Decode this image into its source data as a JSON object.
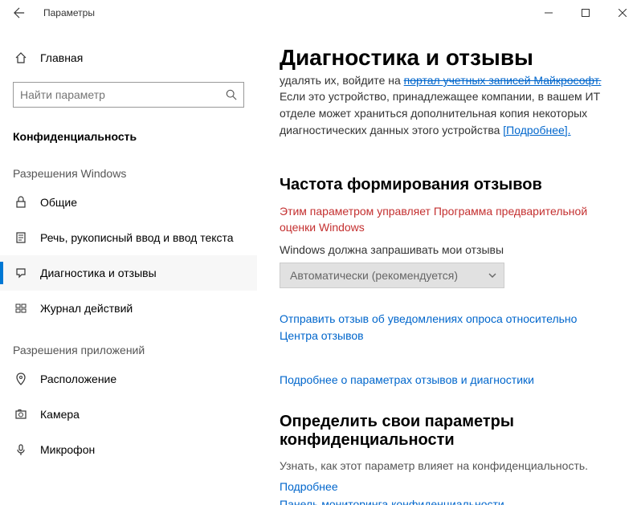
{
  "titlebar": {
    "app_name": "Параметры"
  },
  "sidebar": {
    "home_label": "Главная",
    "search_placeholder": "Найти параметр",
    "section": "Конфиденциальность",
    "group1": "Разрешения Windows",
    "group2": "Разрешения приложений",
    "items_g1": [
      {
        "label": "Общие"
      },
      {
        "label": "Речь, рукописный ввод и ввод текста"
      },
      {
        "label": "Диагностика и отзывы"
      },
      {
        "label": "Журнал действий"
      }
    ],
    "items_g2": [
      {
        "label": "Расположение"
      },
      {
        "label": "Камера"
      },
      {
        "label": "Микрофон"
      }
    ]
  },
  "main": {
    "page_title": "Диагностика и отзывы",
    "trunc_prefix": "удалять их, войдите на ",
    "trunc_link": "портал учетных записей Майкрософт.",
    "body1": "Если это устройство, принадлежащее компании, в вашем ИТ отделе может храниться дополнительная копия некоторых диагностических данных этого устройства ",
    "body1_link": "[Подробнее].",
    "h2_feedback": "Частота формирования отзывов",
    "insider_notice": "Этим параметром управляет Программа предварительной оценки Windows",
    "dropdown_label": "Windows должна запрашивать мои отзывы",
    "dropdown_value": "Автоматически (рекомендуется)",
    "link_send_feedback": "Отправить отзыв об уведомлениях опроса относительно Центра отзывов",
    "link_learn_more_feedback": "Подробнее о параметрах отзывов и диагностики",
    "h2_privacy": "Определить свои параметры конфиденциальности",
    "privacy_subtext": "Узнать, как этот параметр влияет на конфиденциальность.",
    "link_more": "Подробнее",
    "link_dashboard": "Панель мониторинга конфиденциальности"
  }
}
